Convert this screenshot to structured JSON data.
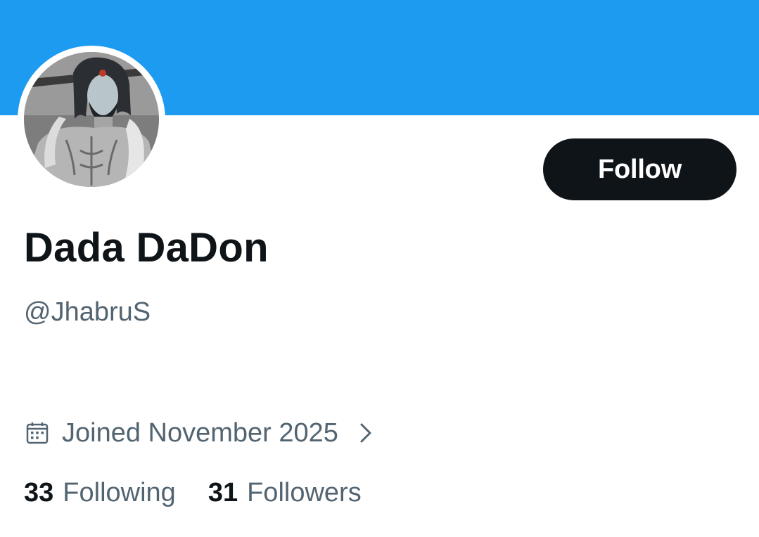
{
  "colors": {
    "banner": "#1d9bf0",
    "primary_text": "#0f1419",
    "secondary_text": "#536471",
    "follow_button_bg": "#0f1419",
    "follow_button_text": "#ffffff"
  },
  "profile": {
    "display_name": "Dada DaDon",
    "handle": "@JhabruS",
    "follow_label": "Follow",
    "avatar_icon": "avatar-photo",
    "joined": {
      "icon": "calendar-icon",
      "text": "Joined November 2025",
      "chevron_icon": "chevron-right-icon"
    },
    "stats": {
      "following_count": "33",
      "following_label": "Following",
      "followers_count": "31",
      "followers_label": "Followers"
    }
  }
}
